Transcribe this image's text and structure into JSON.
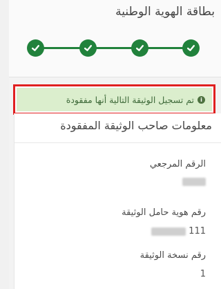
{
  "card": {
    "title": "بطاقة الهوية الوطنية",
    "steps": [
      {
        "status": "complete",
        "icon": "check-icon"
      },
      {
        "status": "complete",
        "icon": "check-icon"
      },
      {
        "status": "complete",
        "icon": "check-icon"
      },
      {
        "status": "complete",
        "icon": "check-icon"
      }
    ]
  },
  "alert": {
    "icon": "info-icon",
    "message": "تم تسجيل الوثيقة التالية أنها مفقودة"
  },
  "info": {
    "title": "معلومات صاحب الوثيقة المفقودة",
    "reference_label": "الرقم المرجعي",
    "holder_id_label": "رقم هوية حامل الوثيقة",
    "holder_id_value": "111",
    "copy_label": "رقم نسخة الوثيقة",
    "copy_value": "1"
  },
  "colors": {
    "success": "#21823c",
    "alert_bg": "#dbeecd",
    "highlight": "#e02020"
  }
}
